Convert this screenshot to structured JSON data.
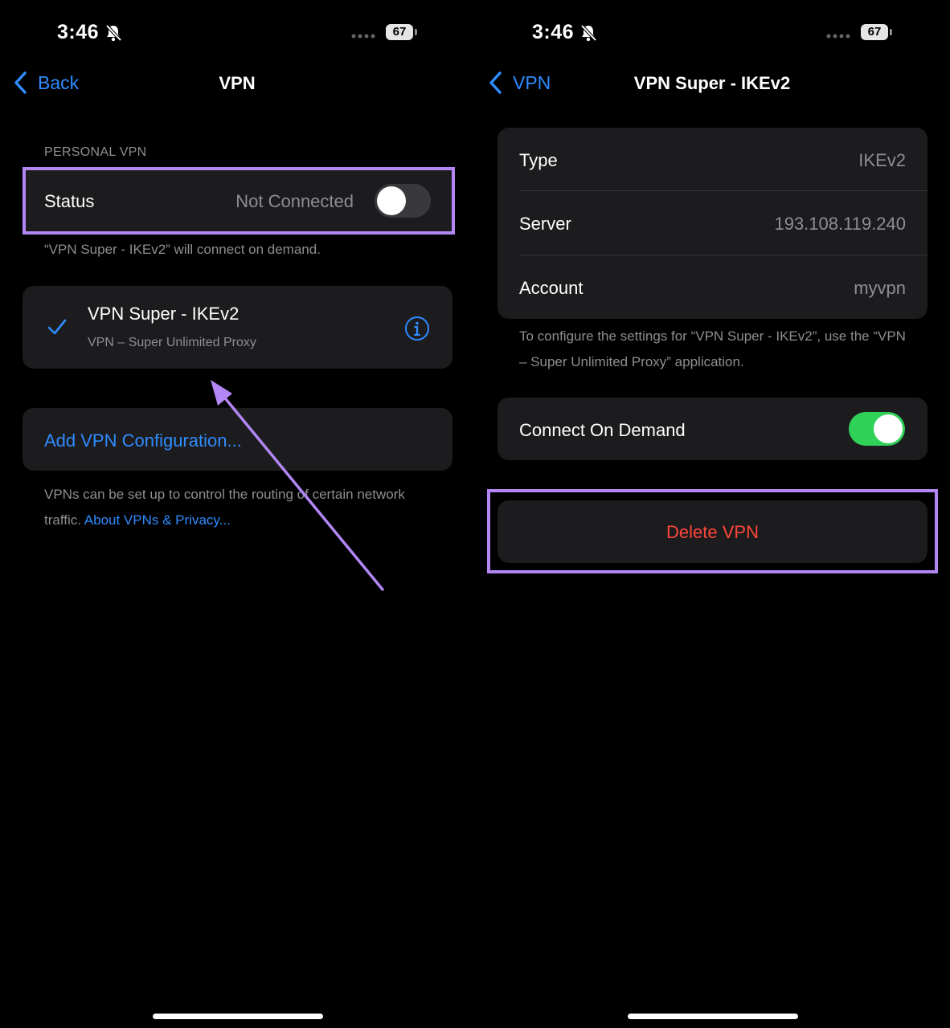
{
  "status_bar": {
    "time": "3:46",
    "battery": "67"
  },
  "left_screen": {
    "nav": {
      "back_label": "Back",
      "title": "VPN"
    },
    "section_header": "PERSONAL VPN",
    "status_row": {
      "label": "Status",
      "value": "Not Connected",
      "toggle_on": false
    },
    "on_demand_note": "“VPN Super - IKEv2” will connect on demand.",
    "vpn_item": {
      "name": "VPN Super - IKEv2",
      "subtitle": "VPN – Super Unlimited Proxy",
      "selected": true
    },
    "add_config_label": "Add VPN Configuration...",
    "footer": {
      "text": "VPNs can be set up to control the routing of certain network traffic.",
      "link": "About VPNs & Privacy..."
    }
  },
  "right_screen": {
    "nav": {
      "back_label": "VPN",
      "title": "VPN Super - IKEv2"
    },
    "details": [
      {
        "label": "Type",
        "value": "IKEv2"
      },
      {
        "label": "Server",
        "value": "193.108.119.240"
      },
      {
        "label": "Account",
        "value": "myvpn"
      }
    ],
    "config_note": "To configure the settings for “VPN Super - IKEv2”, use the “VPN – Super Unlimited Proxy” application.",
    "connect_on_demand": {
      "label": "Connect On Demand",
      "toggle_on": true
    },
    "delete_label": "Delete VPN"
  },
  "colors": {
    "accent_blue": "#2f8cff",
    "toggle_green": "#30d158",
    "destructive_red": "#ff453a",
    "highlight_purple": "#b287f5"
  }
}
